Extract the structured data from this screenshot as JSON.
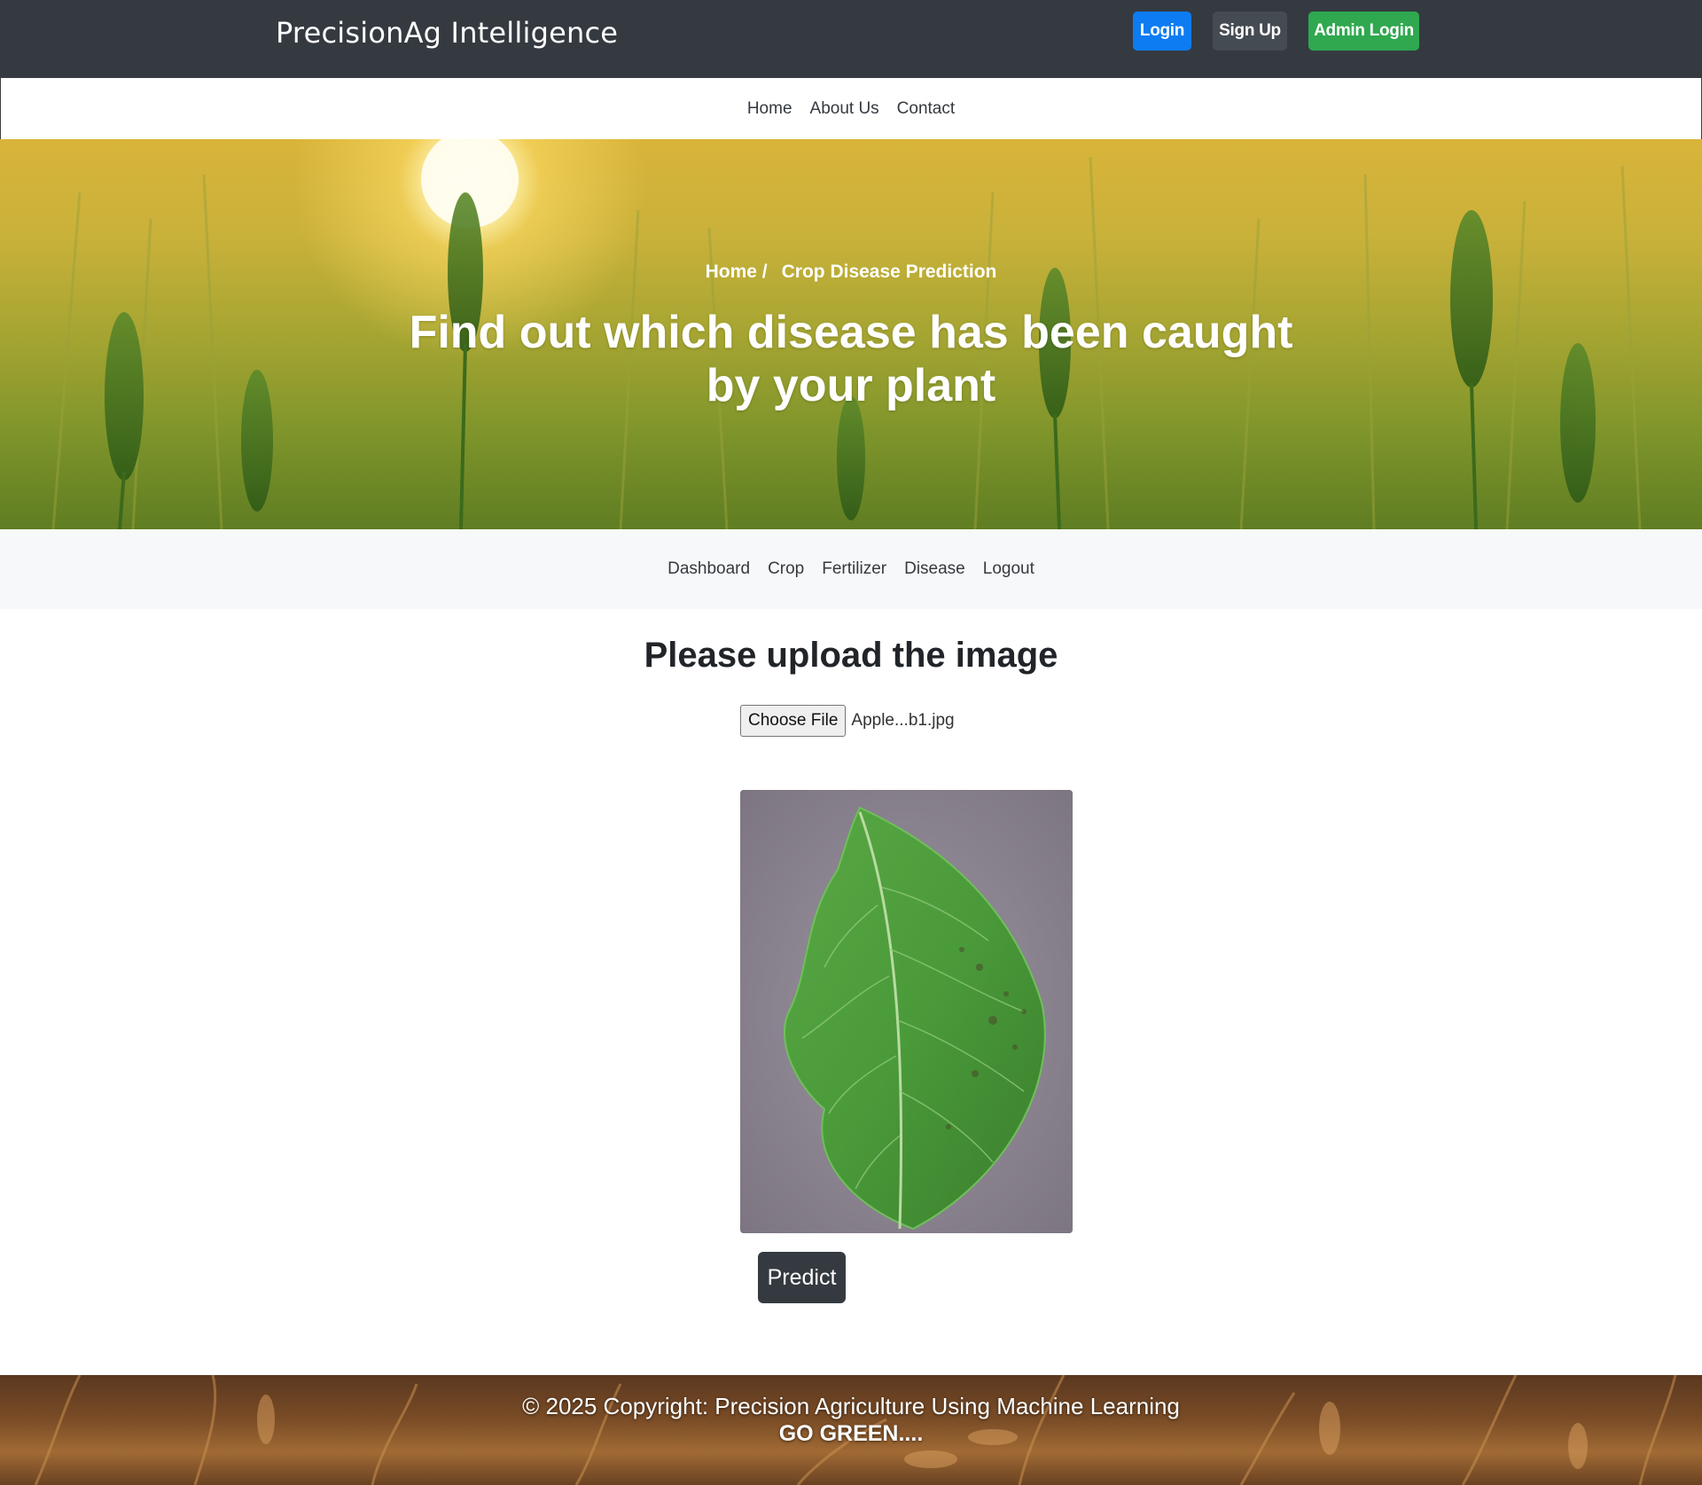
{
  "brand": "PrecisionAg Intelligence",
  "top_buttons": {
    "login": "Login",
    "signup": "Sign Up",
    "admin_login": "Admin Login"
  },
  "main_nav": [
    "Home",
    "About Us",
    "Contact"
  ],
  "hero": {
    "breadcrumb_home": "Home /",
    "breadcrumb_current": "Crop Disease Prediction",
    "title": "Find out which disease has been caught by your plant"
  },
  "sub_nav": [
    "Dashboard",
    "Crop",
    "Fertilizer",
    "Disease",
    "Logout"
  ],
  "upload": {
    "title": "Please upload the image",
    "choose_file": "Choose File",
    "file_name": "Apple...b1.jpg",
    "predict": "Predict"
  },
  "footer": {
    "copyright": "© 2025 Copyright: Precision Agriculture Using Machine Learning",
    "tagline": "GO GREEN...."
  },
  "colors": {
    "topbar": "#343a40",
    "login": "#0d7cf2",
    "signup": "#454b52",
    "admin": "#2fa84f"
  },
  "icons": {
    "preview": "leaf-image"
  }
}
